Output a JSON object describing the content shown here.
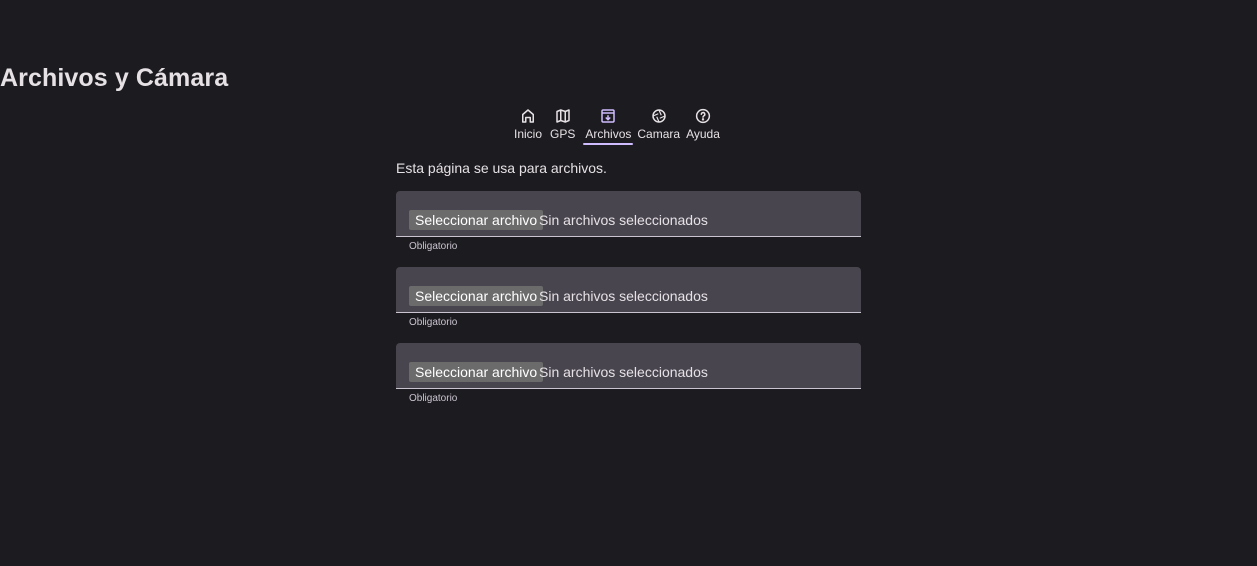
{
  "header": {
    "title": "Archivos y Cámara"
  },
  "nav": {
    "items": [
      {
        "label": "Inicio",
        "icon": "home-icon",
        "active": false
      },
      {
        "label": "GPS",
        "icon": "map-icon",
        "active": false
      },
      {
        "label": "Archivos",
        "icon": "archive-icon",
        "active": true
      },
      {
        "label": "Camara",
        "icon": "camera-aperture-icon",
        "active": false
      },
      {
        "label": "Ayuda",
        "icon": "help-icon",
        "active": false
      }
    ]
  },
  "main": {
    "description": "Esta página se usa para archivos.",
    "file_fields": [
      {
        "button": "Seleccionar archivo",
        "status": "Sin archivos seleccionados",
        "helper": "Obligatorio"
      },
      {
        "button": "Seleccionar archivo",
        "status": "Sin archivos seleccionados",
        "helper": "Obligatorio"
      },
      {
        "button": "Seleccionar archivo",
        "status": "Sin archivos seleccionados",
        "helper": "Obligatorio"
      }
    ]
  },
  "colors": {
    "background": "#1c1b1f",
    "field_background": "#49454f",
    "accent": "#cfbcff"
  }
}
